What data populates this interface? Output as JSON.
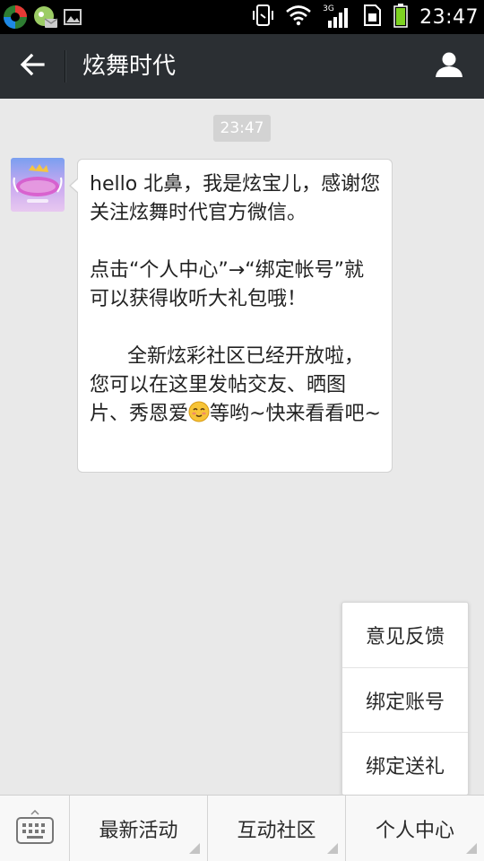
{
  "status_bar": {
    "time": "23:47",
    "network_label": "3G",
    "icons": [
      "app-icon-1",
      "app-icon-2",
      "image-icon",
      "phone-vibrate-icon",
      "wifi-icon",
      "signal-icon",
      "sim-icon",
      "battery-icon"
    ],
    "battery_color": "#7ed321"
  },
  "header": {
    "title": "炫舞时代",
    "back_icon": "back-arrow-icon",
    "profile_icon": "person-icon"
  },
  "chat": {
    "timestamp": "23:47",
    "message": {
      "paragraph1": "hello 北鼻，我是炫宝儿，感谢您关注炫舞时代官方微信。",
      "paragraph2": "点击“个人中心”→“绑定帐号”就可以获得收听大礼包哦！",
      "paragraph3_before": "      全新炫彩社区已经开放啦，您可以在这里发帖交友、晒图片、秀恩爱",
      "paragraph3_emoji": "smiling-emoji-icon",
      "paragraph3_after": "等哟~快来看看吧~"
    }
  },
  "popup_menu": {
    "items": [
      "意见反馈",
      "绑定账号",
      "绑定送礼"
    ]
  },
  "bottom_menu": {
    "keyboard_icon": "keyboard-icon",
    "tabs": [
      "最新活动",
      "互动社区",
      "个人中心"
    ]
  },
  "colors": {
    "header_bg": "#2b2f33",
    "chat_bg": "#e9e9e9",
    "timestamp_bg": "#d3d3d3"
  }
}
